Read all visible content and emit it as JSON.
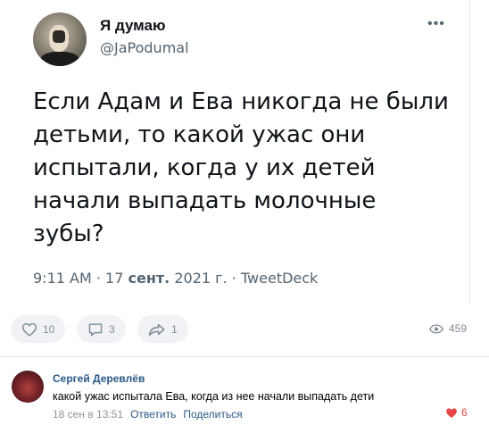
{
  "tweet": {
    "author_name": "Я думаю",
    "author_handle": "@JaPodumal",
    "more_label": "•••",
    "text": "Если Адам и Ева никогда не были детьми, то какой ужас они испытали, когда у их детей начали выпадать молочные зубы?",
    "time": "9:11 AM",
    "date_day": "17",
    "date_month": "сент.",
    "date_year": "2021 г.",
    "source": "TweetDeck",
    "separator": "·"
  },
  "actions": {
    "likes": "10",
    "comments": "3",
    "reposts": "1",
    "views": "459"
  },
  "comment": {
    "author": "Сергей Деревлёв",
    "text": "какой ужас испытала Ева, когда из нее начали выпадать дети",
    "timestamp": "18 сен в 13:51",
    "reply_label": "Ответить",
    "share_label": "Поделиться",
    "likes": "6"
  },
  "colors": {
    "accent_link": "#2a5885",
    "like_active": "#e64646",
    "muted": "#818c99"
  }
}
